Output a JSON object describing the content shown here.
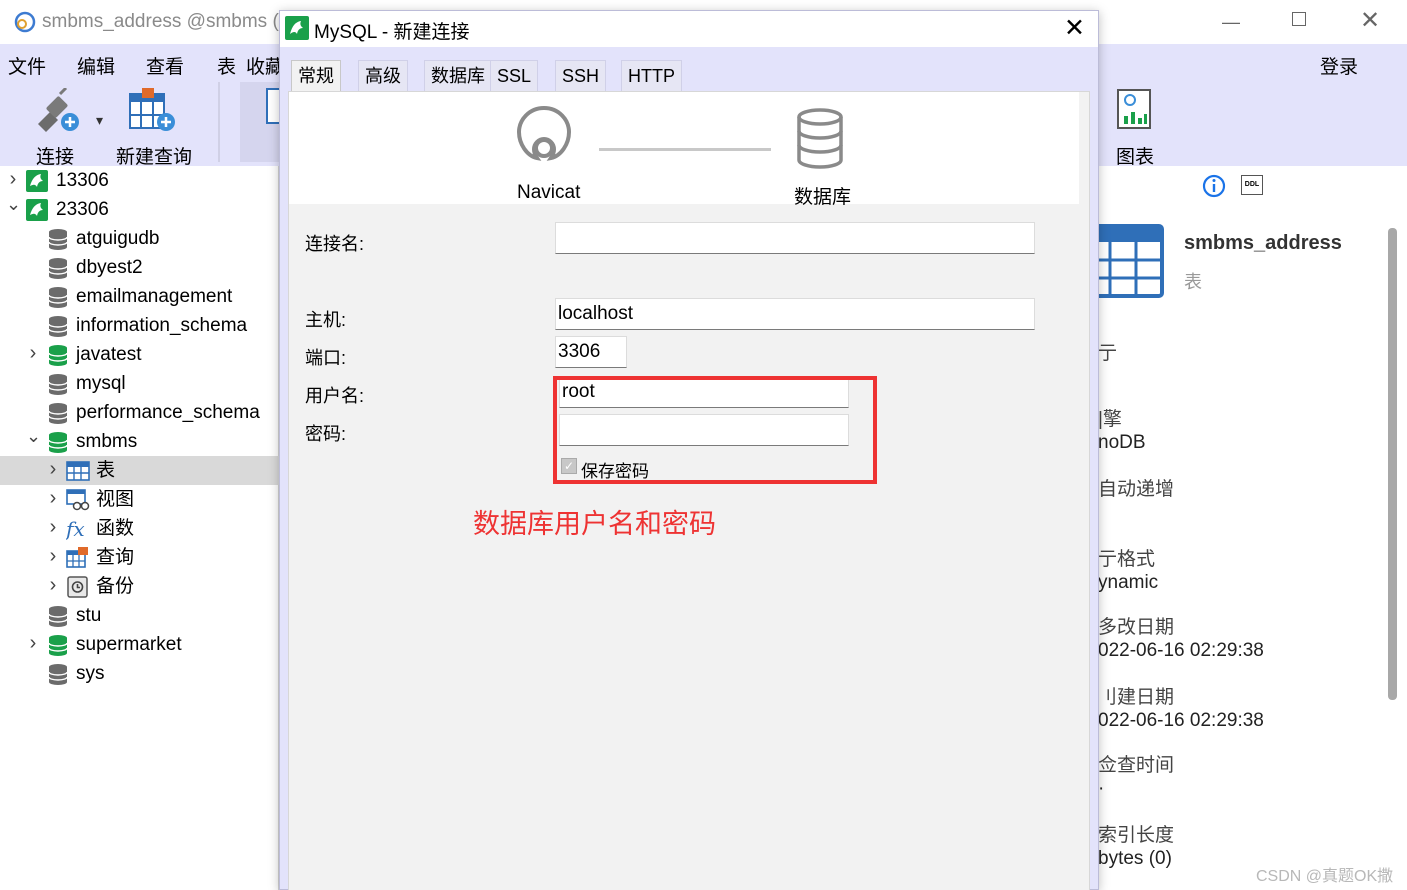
{
  "window": {
    "title": "smbms_address @smbms (",
    "login_label": "登录"
  },
  "menu": [
    "文件",
    "编辑",
    "查看",
    "表",
    "收藏"
  ],
  "toolbar": {
    "connect_label": "连接",
    "new_query_label": "新建查询",
    "chart_label": "图表"
  },
  "sidebar": {
    "items": [
      {
        "label": "13306",
        "type": "connection",
        "expand": "collapsed"
      },
      {
        "label": "23306",
        "type": "connection",
        "expand": "expanded"
      },
      {
        "label": "atguigudb",
        "type": "database-closed",
        "expand": "none"
      },
      {
        "label": "dbyest2",
        "type": "database-closed",
        "expand": "none"
      },
      {
        "label": "emailmanagement",
        "type": "database-closed",
        "expand": "none"
      },
      {
        "label": "information_schema",
        "type": "database-closed",
        "expand": "none"
      },
      {
        "label": "javatest",
        "type": "database-open",
        "expand": "collapsed"
      },
      {
        "label": "mysql",
        "type": "database-closed",
        "expand": "none"
      },
      {
        "label": "performance_schema",
        "type": "database-closed",
        "expand": "none"
      },
      {
        "label": "smbms",
        "type": "database-open",
        "expand": "expanded"
      },
      {
        "label": "表",
        "type": "tables",
        "expand": "collapsed",
        "selected": true
      },
      {
        "label": "视图",
        "type": "views",
        "expand": "collapsed"
      },
      {
        "label": "函数",
        "type": "functions",
        "expand": "collapsed"
      },
      {
        "label": "查询",
        "type": "queries",
        "expand": "collapsed"
      },
      {
        "label": "备份",
        "type": "backups",
        "expand": "collapsed"
      },
      {
        "label": "stu",
        "type": "database-closed",
        "expand": "none"
      },
      {
        "label": "supermarket",
        "type": "database-open",
        "expand": "collapsed"
      },
      {
        "label": "sys",
        "type": "database-closed",
        "expand": "none"
      }
    ]
  },
  "dialog": {
    "title": "MySQL - 新建连接",
    "tabs": [
      "常规",
      "高级",
      "数据库",
      "SSL",
      "SSH",
      "HTTP"
    ],
    "active_tab": "常规",
    "diagram": {
      "left_label": "Navicat",
      "right_label": "数据库"
    },
    "fields": {
      "connection_name": {
        "label": "连接名:",
        "value": ""
      },
      "host": {
        "label": "主机:",
        "value": "localhost"
      },
      "port": {
        "label": "端口:",
        "value": "3306"
      },
      "username": {
        "label": "用户名:",
        "value": "root"
      },
      "password": {
        "label": "密码:",
        "value": ""
      },
      "save_password": {
        "label": "保存密码",
        "checked": true
      }
    },
    "annotation": "数据库用户名和密码"
  },
  "right_panel": {
    "object_name": "smbms_address",
    "object_type": "表",
    "props": [
      {
        "label": "亍",
        "value": ""
      },
      {
        "label": "|擎",
        "value": "noDB"
      },
      {
        "label": "自动递增",
        "value": ""
      },
      {
        "label": "亍格式",
        "value": "ynamic"
      },
      {
        "label": "多改日期",
        "value": "022-06-16 02:29:38"
      },
      {
        "label": "刂建日期",
        "value": "022-06-16 02:29:38"
      },
      {
        "label": "佥查时间",
        "value": "·"
      },
      {
        "label": "索引长度",
        "value": "bytes (0)"
      }
    ]
  },
  "watermark": "CSDN @真题OK撒",
  "colors": {
    "chrome": "#e3e3fb",
    "selection": "#d9d9d9",
    "annotation_red": "#ee3333",
    "info_blue": "#1a73e8"
  }
}
